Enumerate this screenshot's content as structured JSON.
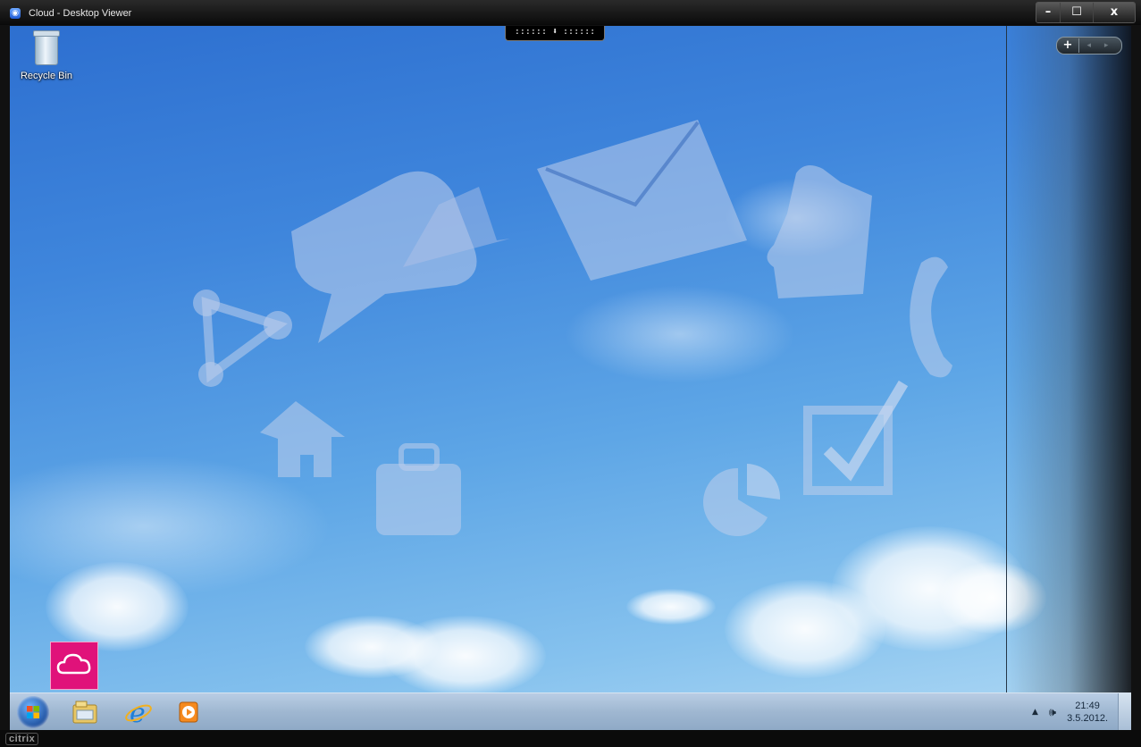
{
  "window": {
    "title": "Cloud - Desktop Viewer",
    "controls": {
      "minimize": "–",
      "maximize": "☐",
      "close": "x"
    }
  },
  "toolbar_tab": {
    "label": ":::::: ⬇ ::::::"
  },
  "desktop": {
    "icons": [
      {
        "label": "Recycle Bin",
        "icon": "recycle-bin-icon"
      }
    ],
    "app_tile": {
      "icon": "cloud-icon",
      "color": "#e0127a"
    }
  },
  "side_panel": {
    "plus": "+",
    "arrows": "◂ ▸"
  },
  "taskbar": {
    "pinned": [
      "start-orb-icon",
      "windows-explorer-icon",
      "internet-explorer-icon",
      "media-player-icon"
    ],
    "tray": {
      "arrow": "▲",
      "volume": "🕪",
      "time": "21:49",
      "date": "3.5.2012."
    }
  },
  "footer": {
    "brand": "citrix"
  }
}
